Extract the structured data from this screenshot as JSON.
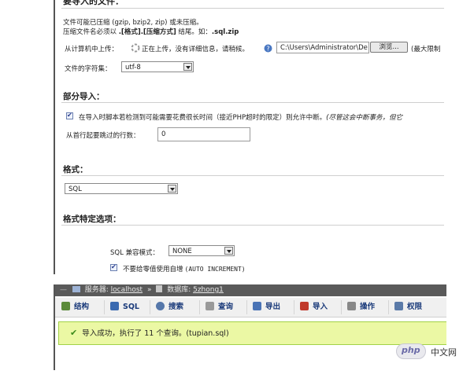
{
  "import_form": {
    "file_section_title": "要导入的文件：",
    "compress_note": "文件可能已压缩 (gzip, bzip2, zip) 或未压缩。",
    "ext_note_prefix": "压缩文件名必须以 ",
    "ext_note_bold": ".[格式].[压缩方式]",
    "ext_note_mid": " 结尾。如：",
    "ext_note_example": ".sql.zip",
    "upload_label": "从计算机中上传：",
    "upload_status": "正在上传，没有详细信息，请稍候。",
    "file_path_value": "C:\\Users\\Administrator\\De",
    "browse_button": "浏览...",
    "max_limit_note": "(最大限制",
    "charset_label": "文件的字符集：",
    "charset_value": "utf-8",
    "partial_title": "部分导入：",
    "allow_interrupt_text": "在导入时脚本若检测到可能需要花费很长时间（接近PHP超时的限定）则允许中断。",
    "allow_interrupt_note": "(尽管这会中断事务，但它",
    "skip_rows_label": "从首行起要跳过的行数：",
    "skip_rows_value": "0",
    "format_title": "格式：",
    "format_value": "SQL",
    "format_options_title": "格式特定选项：",
    "sql_compat_label": "SQL 兼容模式：",
    "sql_compat_value": "NONE",
    "no_auto_value_text": "不要给零值使用自增",
    "no_auto_value_code": "(AUTO INCREMENT)"
  },
  "result_view": {
    "breadcrumb_server_label": "服务器: ",
    "breadcrumb_server": "localhost",
    "breadcrumb_sep": "»",
    "breadcrumb_db_label": "数据库: ",
    "breadcrumb_db": "5zhong1",
    "tabs": [
      {
        "label": "结构",
        "icon": "structure-icon",
        "color": "#5b8a3a"
      },
      {
        "label": "SQL",
        "icon": "sql-icon",
        "color": "#3a6ab0"
      },
      {
        "label": "搜索",
        "icon": "search-icon",
        "color": "#5577aa"
      },
      {
        "label": "查询",
        "icon": "query-icon",
        "color": "#777777"
      },
      {
        "label": "导出",
        "icon": "export-icon",
        "color": "#4a73b5"
      },
      {
        "label": "导入",
        "icon": "import-icon",
        "color": "#c0392b"
      },
      {
        "label": "操作",
        "icon": "operations-icon",
        "color": "#888888"
      },
      {
        "label": "权限",
        "icon": "privileges-icon",
        "color": "#5a7aa8"
      }
    ],
    "success_message": "导入成功，执行了 11 个查询。(tupian.sql)"
  },
  "watermark": {
    "brand": "php",
    "text": "中文网"
  }
}
